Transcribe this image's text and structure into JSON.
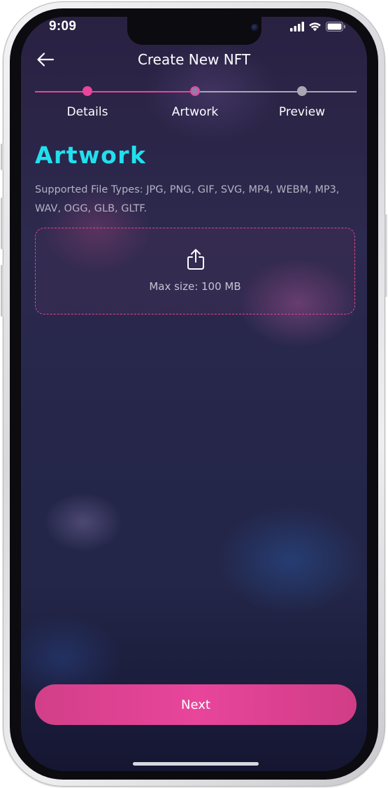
{
  "status_bar": {
    "time": "9:09",
    "icons": [
      "cellular-signal-icon",
      "wifi-icon",
      "battery-icon"
    ]
  },
  "header": {
    "title": "Create New NFT",
    "back_icon": "arrow-left-icon"
  },
  "stepper": {
    "steps": [
      {
        "label": "Details",
        "state": "completed"
      },
      {
        "label": "Artwork",
        "state": "current"
      },
      {
        "label": "Preview",
        "state": "upcoming"
      }
    ],
    "colors": {
      "active": "#e8459b",
      "inactive": "#a9a7b3"
    }
  },
  "artwork": {
    "title": "Artwork",
    "supported_types": "Supported File Types: JPG, PNG, GIF, SVG, MP4, WEBM, MP3, WAV, OGG, GLB, GLTF.",
    "upload_icon": "upload-share-icon",
    "max_size": "Max size: 100 MB"
  },
  "footer": {
    "next_label": "Next"
  },
  "colors": {
    "accent_pink": "#e8459b",
    "title_cyan": "#21e0ee"
  }
}
